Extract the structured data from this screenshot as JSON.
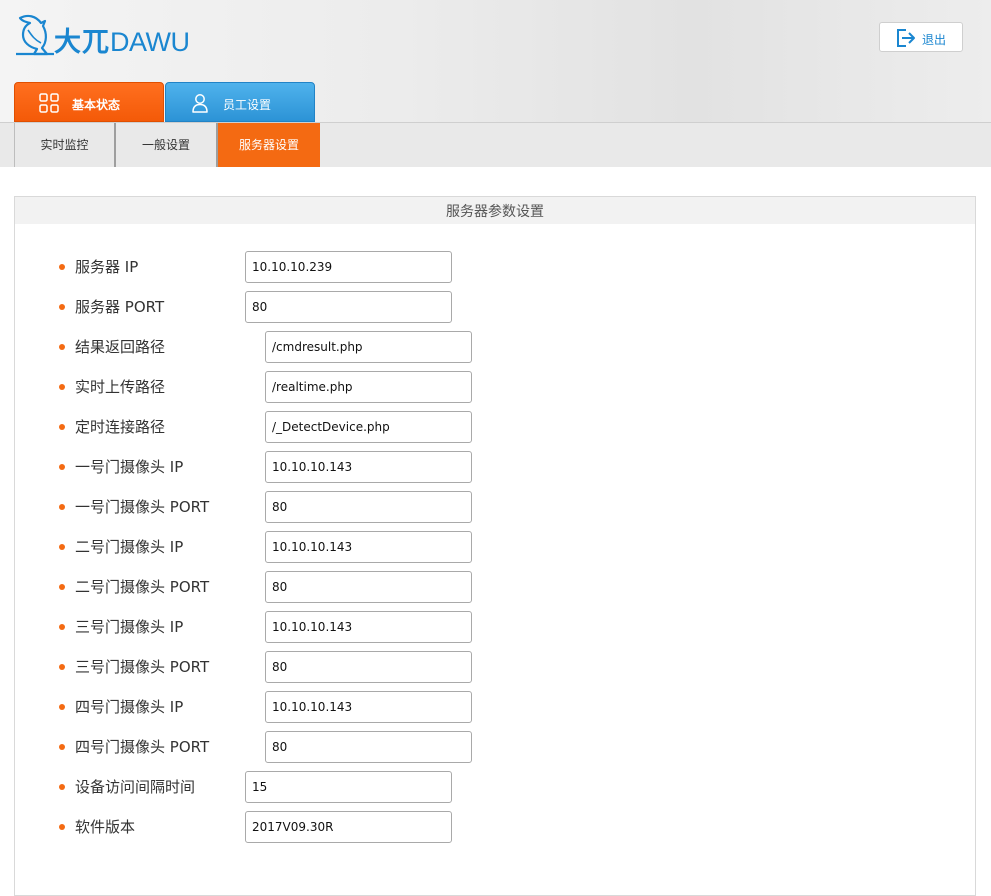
{
  "header": {
    "logo_cn": "大兀",
    "logo_en": "DAWU",
    "logout_label": "退出"
  },
  "main_tabs": [
    {
      "label": "基本状态",
      "active": true
    },
    {
      "label": "员工设置",
      "active": false
    }
  ],
  "sub_tabs": [
    {
      "label": "实时监控"
    },
    {
      "label": "一般设置"
    },
    {
      "label": "服务器设置",
      "active": true
    }
  ],
  "panel": {
    "title": "服务器参数设置",
    "fields": [
      {
        "label": "服务器 IP",
        "value": "10.10.10.239"
      },
      {
        "label": "服务器 PORT",
        "value": "80"
      },
      {
        "label": "结果返回路径",
        "value": "/cmdresult.php"
      },
      {
        "label": "实时上传路径",
        "value": "/realtime.php"
      },
      {
        "label": "定时连接路径",
        "value": "/_DetectDevice.php"
      },
      {
        "label": "一号门摄像头 IP",
        "value": "10.10.10.143"
      },
      {
        "label": "一号门摄像头 PORT",
        "value": "80"
      },
      {
        "label": "二号门摄像头 IP",
        "value": "10.10.10.143"
      },
      {
        "label": "二号门摄像头 PORT",
        "value": "80"
      },
      {
        "label": "三号门摄像头 IP",
        "value": "10.10.10.143"
      },
      {
        "label": "三号门摄像头 PORT",
        "value": "80"
      },
      {
        "label": "四号门摄像头 IP",
        "value": "10.10.10.143"
      },
      {
        "label": "四号门摄像头 PORT",
        "value": "80"
      },
      {
        "label": "设备访问间隔时间",
        "value": "15"
      },
      {
        "label": "软件版本",
        "value": "2017V09.30R"
      }
    ]
  },
  "colors": {
    "accent_orange": "#f46a12",
    "accent_blue": "#2c93d6",
    "brand_blue": "#1a86d0"
  },
  "icons": {
    "logo": "bird-logo-icon",
    "logout": "logout-icon",
    "basic": "grid-icon",
    "staff": "user-icon"
  }
}
